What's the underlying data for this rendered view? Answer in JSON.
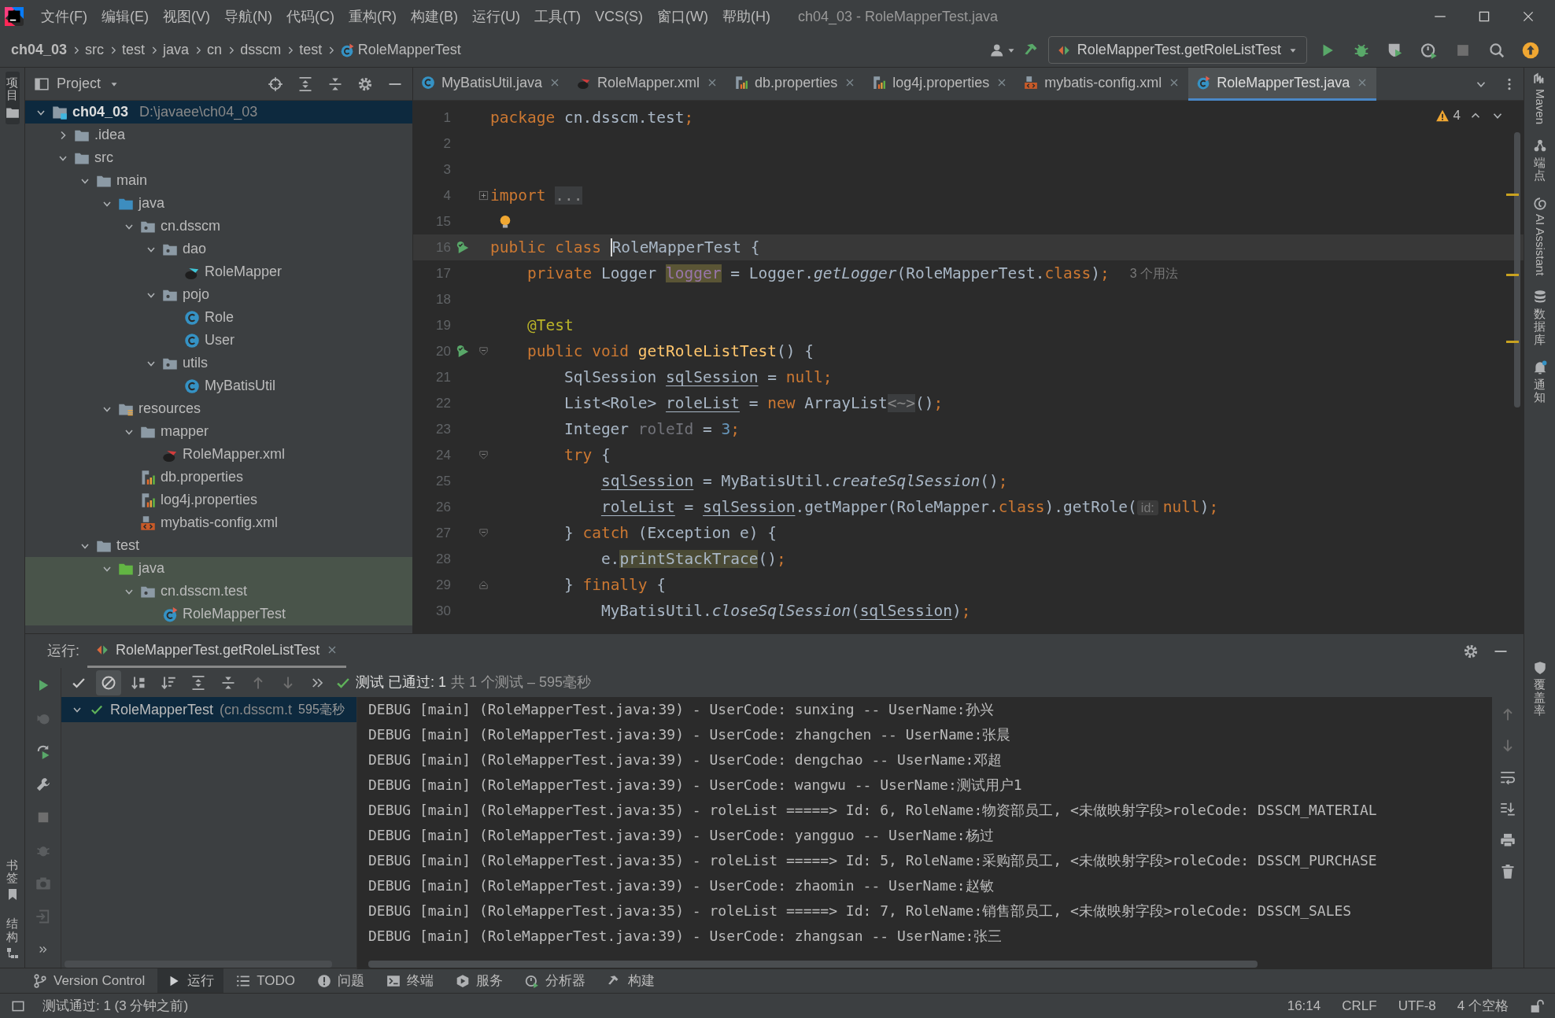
{
  "menu": [
    "文件(F)",
    "编辑(E)",
    "视图(V)",
    "导航(N)",
    "代码(C)",
    "重构(R)",
    "构建(B)",
    "运行(U)",
    "工具(T)",
    "VCS(S)",
    "窗口(W)",
    "帮助(H)"
  ],
  "window_title": "ch04_03 - RoleMapperTest.java",
  "breadcrumb": [
    "ch04_03",
    "src",
    "test",
    "java",
    "cn",
    "dsscm",
    "test",
    "RoleMapperTest"
  ],
  "run_config": "RoleMapperTest.getRoleListTest",
  "left_stripe": [
    {
      "label": "项目",
      "selected": true
    },
    {
      "label": "书签",
      "selected": false
    },
    {
      "label": "结构",
      "selected": false
    }
  ],
  "right_stripe": [
    {
      "label": "Maven",
      "kind": "latin"
    },
    {
      "label": "端点",
      "kind": "cjk"
    },
    {
      "label": "AI Assistant",
      "kind": "latin"
    },
    {
      "label": "数据库",
      "kind": "cjk"
    },
    {
      "label": "通知",
      "kind": "cjk"
    },
    {
      "label": "覆盖率",
      "kind": "cjk"
    }
  ],
  "project": {
    "title": "Project",
    "tree": [
      {
        "label": "ch04_03",
        "path": "D:\\javaee\\ch04_03",
        "kind": "module",
        "expanded": true,
        "selected": true,
        "children": [
          {
            "label": ".idea",
            "kind": "folder",
            "expanded": false,
            "selected": false
          },
          {
            "label": "src",
            "kind": "folder",
            "expanded": true,
            "selected": false,
            "children": [
              {
                "label": "main",
                "kind": "folder",
                "expanded": true,
                "selected": false,
                "children": [
                  {
                    "label": "java",
                    "kind": "source-root",
                    "expanded": true,
                    "selected": false,
                    "children": [
                      {
                        "label": "cn.dsscm",
                        "kind": "package",
                        "expanded": true,
                        "selected": false,
                        "children": [
                          {
                            "label": "dao",
                            "kind": "package",
                            "expanded": true,
                            "selected": false,
                            "children": [
                              {
                                "label": "RoleMapper",
                                "kind": "mapper-interface",
                                "selected": false
                              }
                            ]
                          },
                          {
                            "label": "pojo",
                            "kind": "package",
                            "expanded": true,
                            "selected": false,
                            "children": [
                              {
                                "label": "Role",
                                "kind": "class",
                                "selected": false
                              },
                              {
                                "label": "User",
                                "kind": "class",
                                "selected": false
                              }
                            ]
                          },
                          {
                            "label": "utils",
                            "kind": "package",
                            "expanded": true,
                            "selected": false,
                            "children": [
                              {
                                "label": "MyBatisUtil",
                                "kind": "class",
                                "selected": false
                              }
                            ]
                          }
                        ]
                      }
                    ]
                  },
                  {
                    "label": "resources",
                    "kind": "resource-root",
                    "expanded": true,
                    "selected": false,
                    "children": [
                      {
                        "label": "mapper",
                        "kind": "folder",
                        "expanded": true,
                        "selected": false,
                        "children": [
                          {
                            "label": "RoleMapper.xml",
                            "kind": "mapper-xml",
                            "selected": false
                          }
                        ]
                      },
                      {
                        "label": "db.properties",
                        "kind": "properties",
                        "selected": false
                      },
                      {
                        "label": "log4j.properties",
                        "kind": "properties",
                        "selected": false
                      },
                      {
                        "label": "mybatis-config.xml",
                        "kind": "xml",
                        "selected": false
                      }
                    ]
                  }
                ]
              },
              {
                "label": "test",
                "kind": "folder",
                "expanded": true,
                "selected": false,
                "children": [
                  {
                    "label": "java",
                    "kind": "test-root",
                    "expanded": true,
                    "selected": false,
                    "children": [
                      {
                        "label": "cn.dsscm.test",
                        "kind": "package",
                        "expanded": true,
                        "selected": false,
                        "children": [
                          {
                            "label": "RoleMapperTest",
                            "kind": "test-class",
                            "selected": false
                          }
                        ]
                      }
                    ]
                  }
                ]
              }
            ]
          }
        ]
      }
    ]
  },
  "tabs": [
    {
      "label": "MyBatisUtil.java",
      "kind": "class",
      "selected": false
    },
    {
      "label": "RoleMapper.xml",
      "kind": "mapper-xml",
      "selected": false
    },
    {
      "label": "db.properties",
      "kind": "properties",
      "selected": false
    },
    {
      "label": "log4j.properties",
      "kind": "properties",
      "selected": false
    },
    {
      "label": "mybatis-config.xml",
      "kind": "xml",
      "selected": false
    },
    {
      "label": "RoleMapperTest.java",
      "kind": "test-class",
      "selected": true
    }
  ],
  "warnings": "4",
  "code": [
    {
      "number": "1",
      "current": false,
      "tokens": [
        {
          "kind": "kw",
          "text": "package"
        },
        {
          "kind": "txt",
          "text": " cn.dsscm.test"
        },
        {
          "kind": "kw",
          "text": ";"
        }
      ]
    },
    {
      "number": "2",
      "current": false
    },
    {
      "number": "3",
      "current": false
    },
    {
      "number": "4",
      "current": false,
      "fold": {
        "kind": "collapsed"
      },
      "tokens": [
        {
          "kind": "kw",
          "text": "import "
        },
        {
          "kind": "fold",
          "text": "..."
        }
      ]
    },
    {
      "number": "15",
      "current": false,
      "line_icon": {
        "kind": "bulb"
      }
    },
    {
      "number": "16",
      "current": true,
      "gutter": {
        "kind": "run"
      },
      "tokens": [
        {
          "kind": "kw",
          "text": "public class "
        },
        {
          "kind": "caret",
          "text": "RoleMapperTest {"
        }
      ]
    },
    {
      "number": "17",
      "current": false,
      "hint": "3 个用法",
      "tokens": [
        {
          "kind": "kw",
          "text": "    private "
        },
        {
          "kind": "txt",
          "text": "Logger "
        },
        {
          "kind": "field",
          "text": "logger"
        },
        {
          "kind": "txt",
          "text": " = Logger."
        },
        {
          "kind": "it",
          "text": "getLogger"
        },
        {
          "kind": "txt",
          "text": "(RoleMapperTest."
        },
        {
          "kind": "kw",
          "text": "class"
        },
        {
          "kind": "txt",
          "text": ")"
        },
        {
          "kind": "kw",
          "text": ";"
        }
      ]
    },
    {
      "number": "18",
      "current": false
    },
    {
      "number": "19",
      "current": false,
      "tokens": [
        {
          "kind": "ann",
          "text": "    @Test"
        }
      ]
    },
    {
      "number": "20",
      "current": false,
      "gutter": {
        "kind": "run"
      },
      "fold": {
        "kind": "start"
      },
      "tokens": [
        {
          "kind": "kw",
          "text": "    public void "
        },
        {
          "kind": "fn",
          "text": "getRoleListTest"
        },
        {
          "kind": "txt",
          "text": "() {"
        }
      ]
    },
    {
      "number": "21",
      "current": false,
      "tokens": [
        {
          "kind": "txt",
          "text": "        SqlSession "
        },
        {
          "kind": "var",
          "text": "sqlSession"
        },
        {
          "kind": "txt",
          "text": " = "
        },
        {
          "kind": "kw",
          "text": "null;"
        }
      ]
    },
    {
      "number": "22",
      "current": false,
      "tokens": [
        {
          "kind": "txt",
          "text": "        List<Role> "
        },
        {
          "kind": "var",
          "text": "roleList"
        },
        {
          "kind": "txt",
          "text": " = "
        },
        {
          "kind": "kw",
          "text": "new "
        },
        {
          "kind": "txt",
          "text": "ArrayList"
        },
        {
          "kind": "fold",
          "text": "<~>"
        },
        {
          "kind": "txt",
          "text": "()"
        },
        {
          "kind": "kw",
          "text": ";"
        }
      ]
    },
    {
      "number": "23",
      "current": false,
      "tokens": [
        {
          "kind": "txt",
          "text": "        Integer "
        },
        {
          "kind": "gray",
          "text": "roleId"
        },
        {
          "kind": "txt",
          "text": " = "
        },
        {
          "kind": "num",
          "text": "3"
        },
        {
          "kind": "kw",
          "text": ";"
        }
      ]
    },
    {
      "number": "24",
      "current": false,
      "fold": {
        "kind": "start"
      },
      "tokens": [
        {
          "kind": "kw",
          "text": "        try "
        },
        {
          "kind": "txt",
          "text": "{"
        }
      ]
    },
    {
      "number": "25",
      "current": false,
      "tokens": [
        {
          "kind": "var",
          "text": "            sqlSession"
        },
        {
          "kind": "txt",
          "text": " = MyBatisUtil."
        },
        {
          "kind": "it",
          "text": "createSqlSession"
        },
        {
          "kind": "txt",
          "text": "()"
        },
        {
          "kind": "kw",
          "text": ";"
        }
      ]
    },
    {
      "number": "26",
      "current": false,
      "tokens": [
        {
          "kind": "var",
          "text": "            roleList"
        },
        {
          "kind": "txt",
          "text": " = "
        },
        {
          "kind": "var",
          "text": "sqlSession"
        },
        {
          "kind": "txt",
          "text": ".getMapper(RoleMapper."
        },
        {
          "kind": "kw",
          "text": "class"
        },
        {
          "kind": "txt",
          "text": ").getRole("
        },
        {
          "kind": "hint",
          "text": "id:"
        },
        {
          "kind": "kw",
          "text": "null"
        },
        {
          "kind": "txt",
          "text": ")"
        },
        {
          "kind": "kw",
          "text": ";"
        }
      ]
    },
    {
      "number": "27",
      "current": false,
      "fold": {
        "kind": "start"
      },
      "tokens": [
        {
          "kind": "txt",
          "text": "        } "
        },
        {
          "kind": "kw",
          "text": "catch "
        },
        {
          "kind": "txt",
          "text": "(Exception e) {"
        }
      ]
    },
    {
      "number": "28",
      "current": false,
      "tokens": [
        {
          "kind": "txt",
          "text": "            e."
        },
        {
          "kind": "mark",
          "text": "printStackTrace"
        },
        {
          "kind": "txt",
          "text": "()"
        },
        {
          "kind": "kw",
          "text": ";"
        }
      ]
    },
    {
      "number": "29",
      "current": false,
      "fold": {
        "kind": "end"
      },
      "tokens": [
        {
          "kind": "txt",
          "text": "        } "
        },
        {
          "kind": "kw",
          "text": "finally "
        },
        {
          "kind": "txt",
          "text": "{"
        }
      ]
    },
    {
      "number": "30",
      "current": false,
      "tokens": [
        {
          "kind": "txt",
          "text": "            MyBatisUtil."
        },
        {
          "kind": "it",
          "text": "closeSqlSession"
        },
        {
          "kind": "txt",
          "text": "("
        },
        {
          "kind": "var",
          "text": "sqlSession"
        },
        {
          "kind": "txt",
          "text": ")"
        },
        {
          "kind": "kw",
          "text": ";"
        }
      ]
    }
  ],
  "run": {
    "label": "运行:",
    "tab": "RoleMapperTest.getRoleListTest",
    "filters": [
      {
        "kind": "passed",
        "selected": false
      },
      {
        "kind": "ignored",
        "selected": true
      }
    ],
    "status": "测试 已通过: 1",
    "summary": "共 1 个测试 – 595毫秒",
    "tests": [
      {
        "name": "RoleMapperTest",
        "package": "(cn.dsscm.t",
        "time": "595毫秒",
        "passed": true,
        "expanded": true,
        "selected": true
      }
    ],
    "console": [
      "DEBUG [main] (RoleMapperTest.java:39) - UserCode: sunxing -- UserName:孙兴",
      "DEBUG [main] (RoleMapperTest.java:39) - UserCode: zhangchen -- UserName:张晨",
      "DEBUG [main] (RoleMapperTest.java:39) - UserCode: dengchao -- UserName:邓超",
      "DEBUG [main] (RoleMapperTest.java:39) - UserCode: wangwu -- UserName:测试用户1",
      "DEBUG [main] (RoleMapperTest.java:35) - roleList =====> Id: 6, RoleName:物资部员工, <未做映射字段>roleCode: DSSCM_MATERIAL",
      "DEBUG [main] (RoleMapperTest.java:39) - UserCode: yangguo -- UserName:杨过",
      "DEBUG [main] (RoleMapperTest.java:35) - roleList =====> Id: 5, RoleName:采购部员工, <未做映射字段>roleCode: DSSCM_PURCHASE",
      "DEBUG [main] (RoleMapperTest.java:39) - UserCode: zhaomin -- UserName:赵敏",
      "DEBUG [main] (RoleMapperTest.java:35) - roleList =====> Id: 7, RoleName:销售部员工, <未做映射字段>roleCode: DSSCM_SALES",
      "DEBUG [main] (RoleMapperTest.java:39) - UserCode: zhangsan -- UserName:张三"
    ]
  },
  "tool_windows": [
    {
      "label": "Version Control",
      "selected": false
    },
    {
      "label": "运行",
      "selected": true
    },
    {
      "label": "TODO",
      "selected": false
    },
    {
      "label": "问题",
      "selected": false
    },
    {
      "label": "终端",
      "selected": false
    },
    {
      "label": "服务",
      "selected": false
    },
    {
      "label": "分析器",
      "selected": false
    },
    {
      "label": "构建",
      "selected": false
    }
  ],
  "status_bar": {
    "message": "测试通过: 1 (3 分钟之前)",
    "items": [
      "16:14",
      "CRLF",
      "UTF-8",
      "4 个空格"
    ]
  }
}
